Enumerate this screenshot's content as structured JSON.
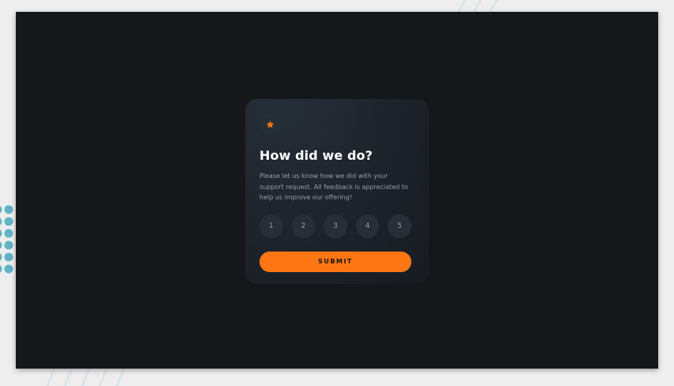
{
  "card": {
    "icon": "star-icon",
    "title": "How did we do?",
    "description": "Please let us know how we did with your support request. All feedback is appreciated to help us improve our offering!",
    "ratings": [
      "1",
      "2",
      "3",
      "4",
      "5"
    ],
    "submit_label": "SUBMIT"
  },
  "colors": {
    "page_background": "#eeeeee",
    "viewport_background": "#15171b",
    "card_background": "#1e252e",
    "accent_orange": "#fc7613",
    "rating_button": "#262e38",
    "text_white": "#ffffff",
    "text_grey": "#959eac",
    "decor_blue": "#62b3c7"
  }
}
